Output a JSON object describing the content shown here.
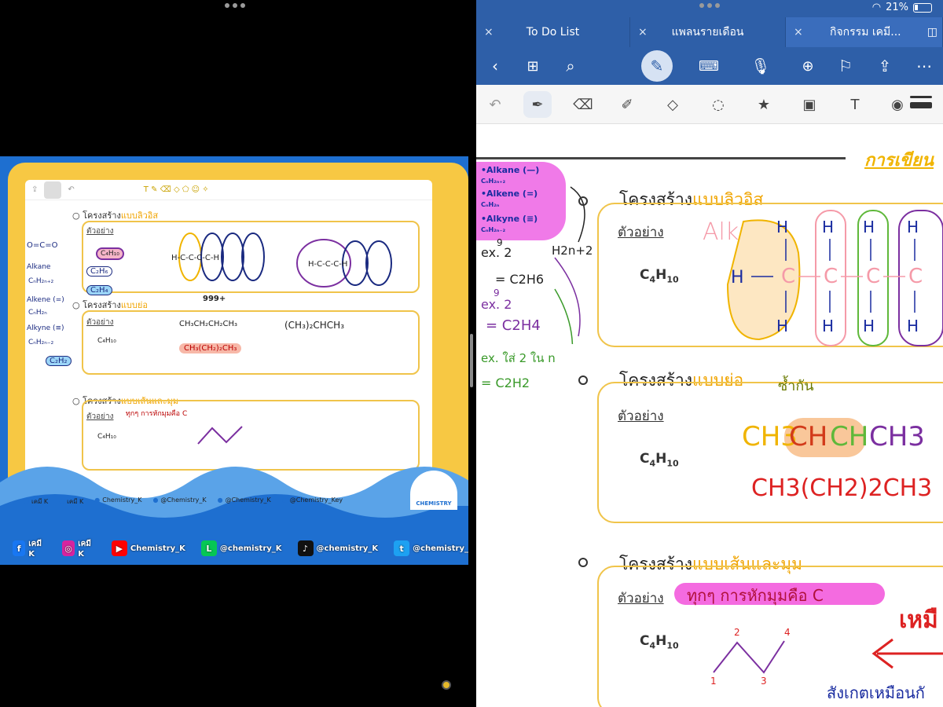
{
  "left": {
    "video_toolbar": {
      "undo": "↶"
    },
    "sections": [
      {
        "heading_prefix": "โครงสร้าง",
        "heading_highlight": "แบบลิวอิส",
        "example": "ตัวอย่าง",
        "formula": "C₄H₁₀",
        "note": "Alkane"
      },
      {
        "heading_prefix": "โครงสร้าง",
        "heading_highlight": "แบบย่อ",
        "example": "ตัวอย่าง",
        "formula": "C₄H₁₀",
        "condensed1": "CH₃CH₂CH₂CH₃",
        "condensed2": "(CH₃)₂CHCH₃",
        "condensed3": "CH₃(CH₂)₂CH₃",
        "annot": "999+"
      },
      {
        "heading_prefix": "โครงสร้าง",
        "heading_highlight": "แบบเส้นและมุม",
        "example": "ตัวอย่าง",
        "formula": "C₄H₁₀",
        "note": "ทุกๆ การหักมุมคือ C"
      }
    ],
    "side_notes": [
      "O=C=O",
      "Alkane",
      "CₙH₂ₙ₊₂",
      "Alkene (=)",
      "CₙH₂ₙ",
      "Alkyne (≡)",
      "CₙH₂ₙ₋₂",
      "C₂H₆",
      "C₂H₄",
      "C₂H₂",
      "C₄H₁₀"
    ],
    "video_social": [
      "เคมี K",
      "เคมี K",
      "Chemistry_K",
      "@Chemistry_K",
      "@Chemistry_K",
      "@Chemistry_Key"
    ],
    "bottom_social": [
      {
        "icon": "f",
        "label": "เคมี K",
        "color": "#1877f2"
      },
      {
        "icon": "◎",
        "label": "เคมี K",
        "color": "#d6249f"
      },
      {
        "icon": "▶",
        "label": "Chemistry_K",
        "color": "#ff0000"
      },
      {
        "icon": "L",
        "label": "@chemistry_K",
        "color": "#06c755"
      },
      {
        "icon": "♪",
        "label": "@chemistry_K",
        "color": "#111111"
      },
      {
        "icon": "t",
        "label": "@chemistry_",
        "color": "#1da1f2"
      }
    ],
    "chem_logo": "CHEMISTRY"
  },
  "right": {
    "status": {
      "battery": "21%"
    },
    "tabs": [
      {
        "label": "To Do List",
        "close": "×"
      },
      {
        "label": "แพลนรายเดือน",
        "close": "×"
      },
      {
        "label": "กิจกรรม เคมี...",
        "close": "×"
      }
    ],
    "toolbar_icons": [
      "back-icon",
      "grid-icon",
      "search-icon",
      "pen-mode-icon",
      "keyboard-icon",
      "microphone-icon",
      "add-page-icon",
      "bookmark-icon",
      "share-icon",
      "more-icon"
    ],
    "tools": [
      "undo",
      "pen",
      "eraser",
      "highlighter",
      "shapes",
      "lasso",
      "sticker",
      "image",
      "text",
      "camera"
    ],
    "doc_title": "การเขียน",
    "pink_notes": [
      "•Alkane (—)",
      "CₙH₂ₙ₊₂",
      "•Alkene (=)",
      "CₙH₂ₙ",
      "•Alkyne (≡)",
      "CₙH₂ₙ₋₂"
    ],
    "margin_notes": {
      "ex1": "ex. 2",
      "h": "H2n+2",
      "c2h6": "= C2H6",
      "ex2": "ex. 2",
      "c2h4": "= C2H4",
      "ex3": "ex. ใส่ 2 ใน n",
      "c2h2": "= C2H2",
      "small1": "9",
      "small2": "9"
    },
    "sections": [
      {
        "heading_prefix": "โครงสร้าง",
        "heading_highlight": "แบบลิวอิส",
        "example": "ตัวอย่าง",
        "formula_main": "C",
        "formula_sub1": "4",
        "formula_h": "H",
        "formula_sub2": "10",
        "hand_label": "Alkane",
        "lewis_atoms": [
          "H",
          "C",
          "C",
          "C",
          "C"
        ]
      },
      {
        "heading_prefix": "โครงสร้าง",
        "heading_highlight": "แบบย่อ",
        "example": "ตัวอย่าง",
        "formula_main": "C",
        "formula_sub1": "4",
        "formula_h": "H",
        "formula_sub2": "10",
        "annot": "ซ้ำกัน",
        "condensed_a": "CH3",
        "condensed_b": "CH",
        "condensed_c": "CH",
        "condensed_d": "CH3",
        "condensed_e": "CH3(CH2)2CH3"
      },
      {
        "heading_prefix": "โครงสร้าง",
        "heading_highlight": "แบบเส้นและมุม",
        "example": "ตัวอย่าง",
        "formula_main": "C",
        "formula_sub1": "4",
        "formula_h": "H",
        "formula_sub2": "10",
        "highlight_note": "ทุกๆ การหักมุมคือ C",
        "side_red": "เหมื",
        "bottom_note": "สังเกตเหมือนกั",
        "zigzag_labels": [
          "1",
          "2",
          "3",
          "4"
        ]
      }
    ]
  }
}
